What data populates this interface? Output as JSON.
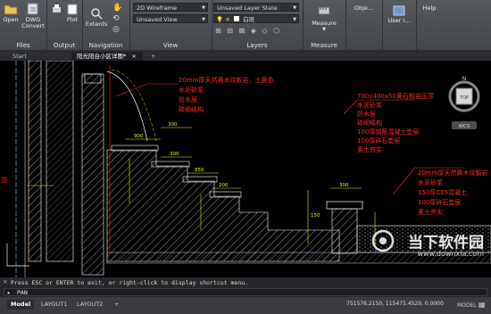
{
  "ribbon": {
    "home": {
      "open": "Open",
      "dwg_convert": "DWG\nConvert",
      "files_title": "Files",
      "print": "Print",
      "plot": "Plot",
      "output_title": "Output",
      "extents": "Extents",
      "navigation_title": "Navigation"
    },
    "view": {
      "visual_style": "2D Wireframe",
      "saved_view": "Unsaved View",
      "title": "View"
    },
    "layers": {
      "layer_state": "Unsaved Layer State",
      "current_layer": "白斑",
      "title": "Layers"
    },
    "measure": {
      "label": "Measure",
      "title": "Measure"
    },
    "objects": {
      "label": "Obje..."
    },
    "help": {
      "label": "Help"
    },
    "user": {
      "label": "User I..."
    }
  },
  "tabs": {
    "start": "Start",
    "drawing": "阳光阳台小区详图*",
    "add": "+"
  },
  "drawing": {
    "annotations_left": [
      "20mm厚天然黄木纹板岩、土黄色",
      "水泥砂浆",
      "防水层",
      "砖砌结构"
    ],
    "annotations_right1": [
      "700x400x50黄石板岩压顶",
      "水泥砂浆",
      "防水层",
      "砖砌结构",
      "100厚钢筋混凝土垫层",
      "100厚碎石垫层",
      "素土夯实"
    ],
    "annotations_right2": [
      "20mm厚天然黄木纹板岩",
      "水泥砂浆",
      "150厚C15混凝土",
      "100厚碎石垫层",
      "素土夯实"
    ],
    "dims": [
      "900",
      "300",
      "850",
      "200",
      "300",
      "150",
      "300"
    ],
    "side_text": "防",
    "viewcube_top": "N",
    "viewcube_face": "TOP",
    "wcs": "WCS"
  },
  "command": {
    "history": "Press ESC or ENTER to exit, or right-click to display shortcut menu.",
    "current": "PAN"
  },
  "status": {
    "model": "Model",
    "layout1": "LAYOUT1",
    "layout2": "LAYOUT2",
    "coords": "751576.2150, 115475.4529, 0.0000",
    "mode": "MODEL"
  },
  "watermark": {
    "name": "当下软件园",
    "url": "www.downxia.com"
  },
  "colors": {
    "annotation": "#ff2b2b",
    "dimension": "#d8ff00",
    "linework": "#ffffff",
    "ground": "#c0c0c0"
  }
}
